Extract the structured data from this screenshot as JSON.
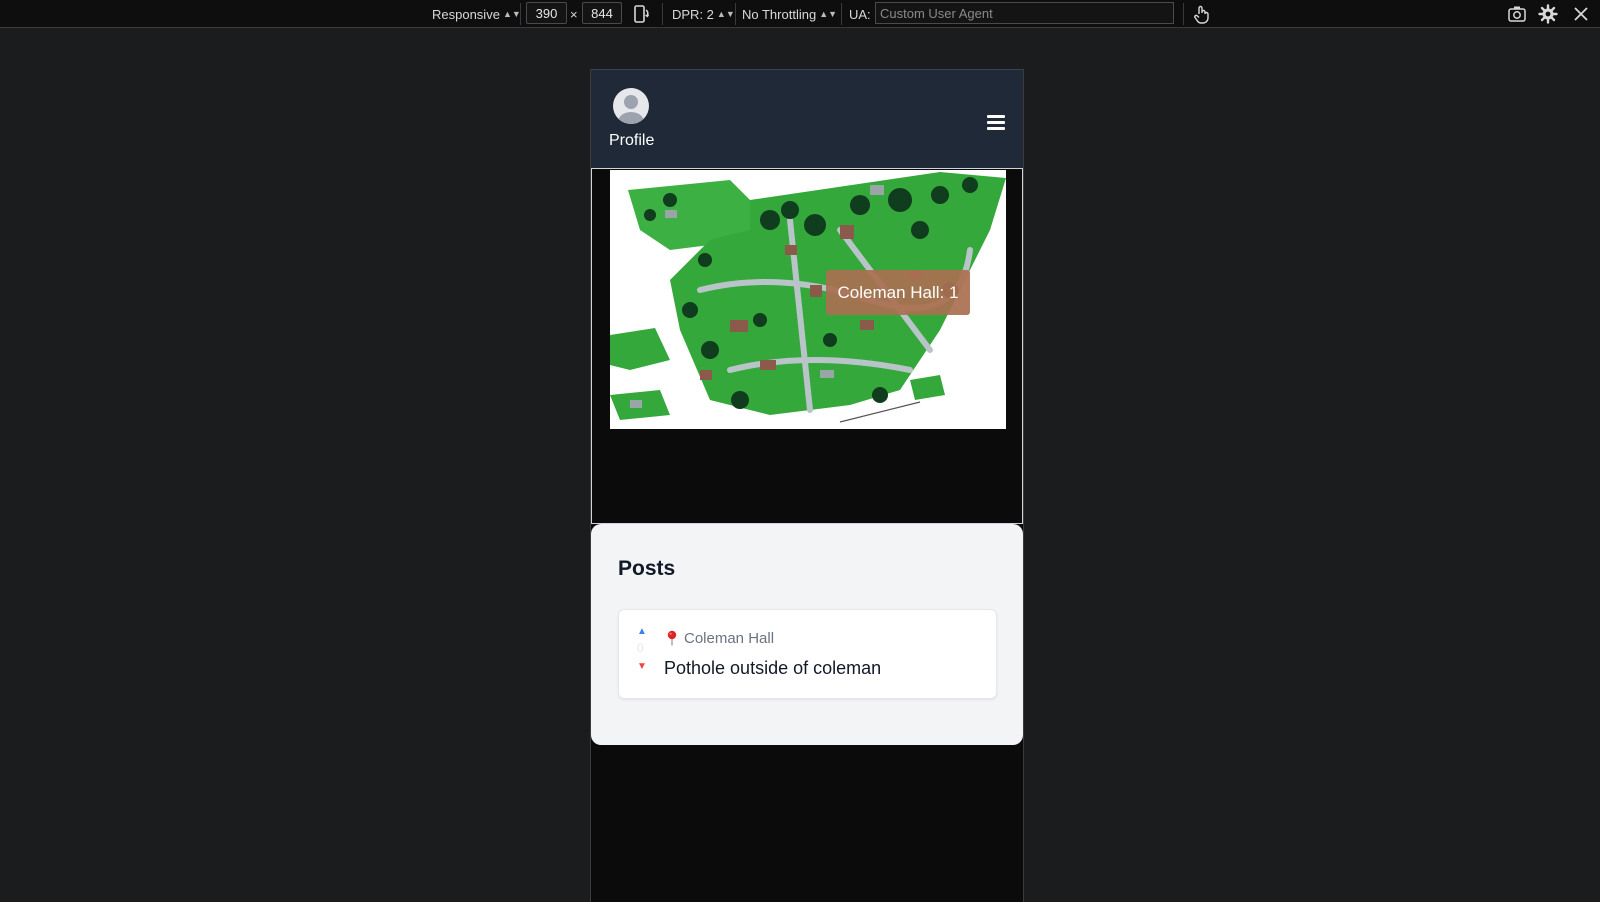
{
  "devtools": {
    "device_mode": "Responsive",
    "width": "390",
    "times": "×",
    "height": "844",
    "dpr": "DPR: 2",
    "throttling": "No Throttling",
    "ua_label": "UA:",
    "ua_placeholder": "Custom User Agent",
    "icons": [
      "rotate-icon",
      "touch-icon",
      "screenshot-icon",
      "settings-icon",
      "close-icon"
    ]
  },
  "header": {
    "profile_label": "Profile",
    "icons": [
      "avatar-icon",
      "hamburger-menu-icon"
    ]
  },
  "map": {
    "tooltip": "Coleman Hall: 1"
  },
  "posts": {
    "title": "Posts",
    "items": [
      {
        "votes": "0",
        "location": "Coleman Hall",
        "text": "Pothole outside of coleman"
      }
    ]
  },
  "colors": {
    "header_bg": "#1f2937",
    "page_bg": "#0b0b0b",
    "panel_bg": "#f3f4f6",
    "upvote": "#3b82f6",
    "downvote": "#ef4444",
    "tooltip": "#aa7052"
  }
}
